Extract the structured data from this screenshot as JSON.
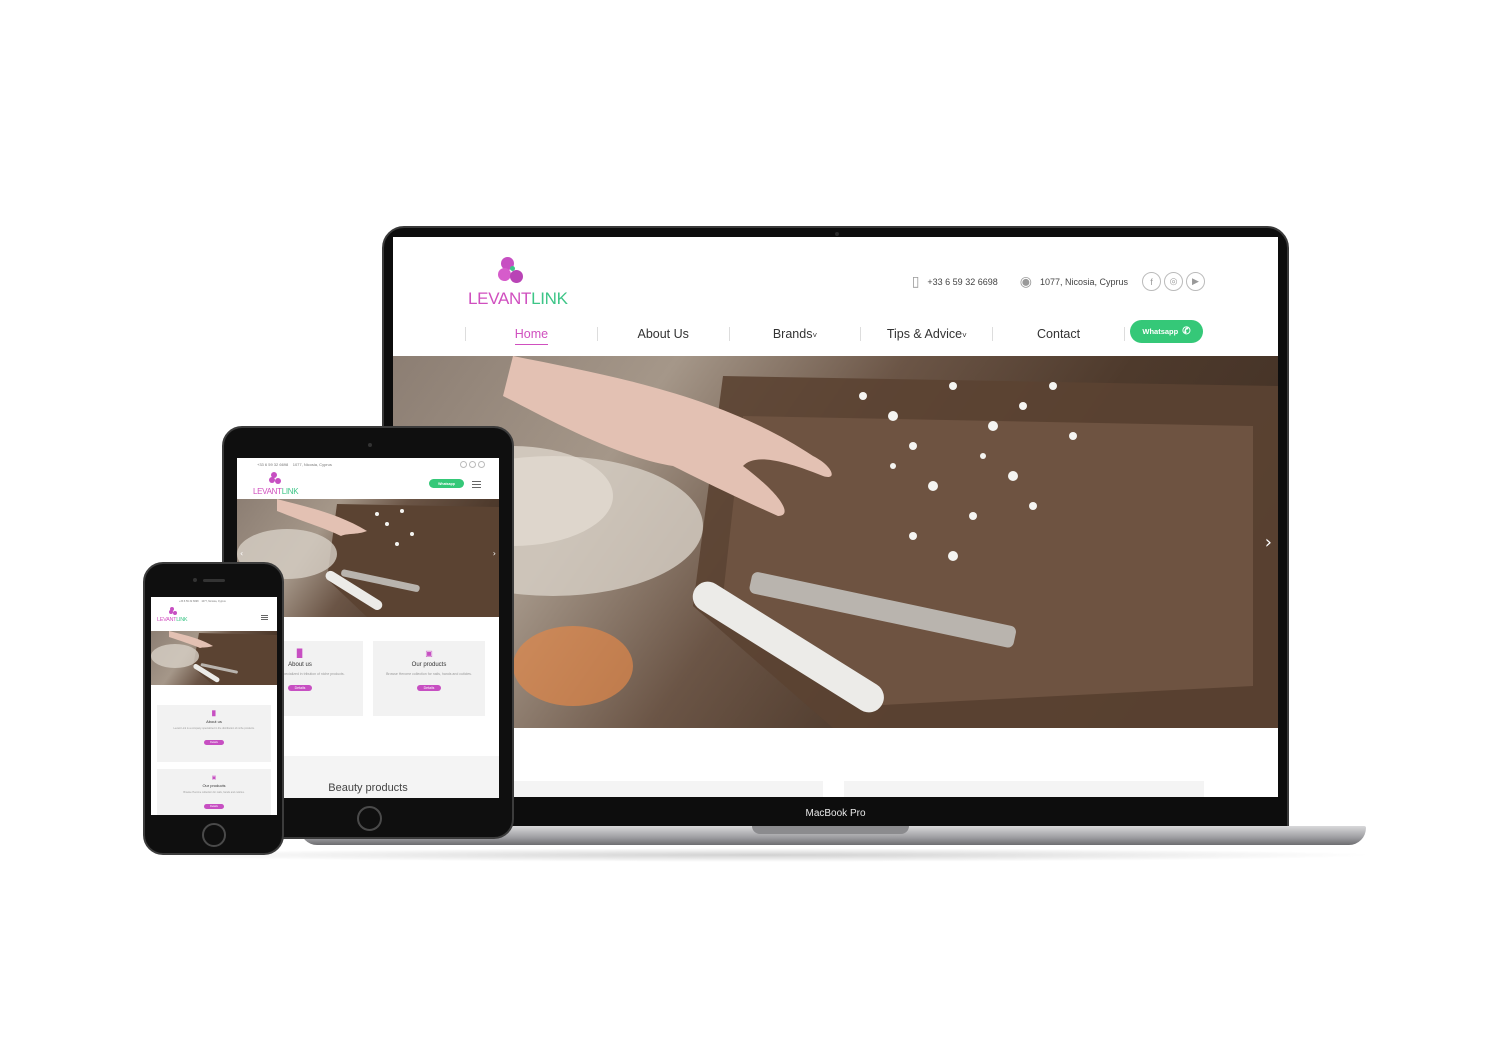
{
  "brand": {
    "name_part1": "LEVANT",
    "name_part2": "LINK",
    "primary": "#d04fbf",
    "secondary": "#3dc587"
  },
  "contact": {
    "phone": "+33 6 59 32 6698",
    "address": "1077, Nicosia, Cyprus"
  },
  "social": [
    "facebook-icon",
    "instagram-icon",
    "youtube-icon"
  ],
  "nav": {
    "home": "Home",
    "about": "About Us",
    "brands": "Brands",
    "tips": "Tips & Advice",
    "contact": "Contact"
  },
  "whatsapp_label": "Whatsapp",
  "hero": {
    "next_arrow": "›",
    "prev_arrow": "‹"
  },
  "device_label": "MacBook Pro",
  "cards": {
    "about": {
      "title": "About us",
      "desc_tablet": "nk is a company specialized in tribution of niche products.",
      "desc_phone": "Levant Link is a company specialized in the distribution of niche products.",
      "btn": "Details"
    },
    "products": {
      "title": "Our products",
      "desc_tablet": "Browse Herome collection for nails, hands and cuticles.",
      "desc_phone": "Browse Herome collection for nails, hands and cuticles.",
      "btn": "Details"
    }
  },
  "section_title": "Beauty products"
}
